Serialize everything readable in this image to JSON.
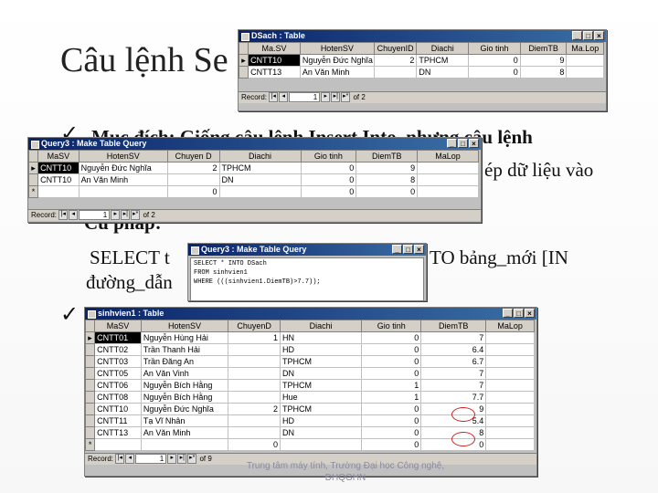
{
  "slide": {
    "title": "Câu lệnh Se",
    "bullet1": "Mục đích: Giống câu lệnh Insert Into, nhưng câu lệnh",
    "bullet1_line2": "ép dữ liệu vào",
    "bullet2": "Cú pháp:",
    "syntax_line1_a": "SELECT t",
    "syntax_line1_b": "TO bảng_mới [IN",
    "syntax_line2": "đường_dẫn",
    "footer": "Trung tâm máy tính, Trường Đại học Công nghệ, ĐHQGHN"
  },
  "dsach": {
    "title": "DSach : Table",
    "columns": [
      "Ma.SV",
      "HotenSV",
      "ChuyenID",
      "Diachi",
      "Gio tinh",
      "DiemTB",
      "Ma.Lop"
    ],
    "rows": [
      [
        "CNTT10",
        "Nguyễn Đức Nghĩa",
        "2",
        "TPHCM",
        "0",
        "9",
        ""
      ],
      [
        "CNTT13",
        "An Văn Minh",
        "",
        "DN",
        "0",
        "8",
        ""
      ]
    ],
    "nav": {
      "label": "Record:",
      "current": "1",
      "of": "of 2"
    }
  },
  "query3a": {
    "title": "Query3 : Make Table Query",
    "columns": [
      "MaSV",
      "HotenSV",
      "Chuyen D",
      "Diachi",
      "Gio tinh",
      "DiemTB",
      "MaLop"
    ],
    "rows": [
      [
        "CNTT10",
        "Nguyễn Đức Nghĩa",
        "2",
        "TPHCM",
        "0",
        "9",
        ""
      ],
      [
        "CNTT10",
        "An Văn Minh",
        "",
        "DN",
        "0",
        "8",
        ""
      ],
      [
        "",
        "",
        "0",
        "",
        "0",
        "0",
        ""
      ]
    ],
    "nav": {
      "label": "Record:",
      "current": "1",
      "of": "of 2"
    }
  },
  "query3b": {
    "title": "Query3 : Make Table Query",
    "sql": "SELECT * INTO DSach\nFROM sinhvien1\nWHERE (((sinhvien1.DiemTB)>7.7));"
  },
  "sinhvien1": {
    "title": "sinhvien1 : Table",
    "columns": [
      "MaSV",
      "HotenSV",
      "ChuyenD",
      "Diachi",
      "Gio tinh",
      "DiemTB",
      "MaLop"
    ],
    "rows": [
      [
        "CNTT01",
        "Nguyễn Hùng Hải",
        "1",
        "HN",
        "0",
        "7",
        ""
      ],
      [
        "CNTT02",
        "Trần Thanh Hải",
        "",
        "HD",
        "0",
        "6.4",
        ""
      ],
      [
        "CNTT03",
        "Trần Đăng An",
        "",
        "TPHCM",
        "0",
        "6.7",
        ""
      ],
      [
        "CNTT05",
        "An Văn Vinh",
        "",
        "DN",
        "0",
        "7",
        ""
      ],
      [
        "CNTT06",
        "Nguyễn Bích Hằng",
        "",
        "TPHCM",
        "1",
        "7",
        ""
      ],
      [
        "CNTT08",
        "Nguyễn Bích Hằng",
        "",
        "Hue",
        "1",
        "7.7",
        ""
      ],
      [
        "CNTT10",
        "Nguyễn Đức Nghĩa",
        "2",
        "TPHCM",
        "0",
        "9",
        ""
      ],
      [
        "CNTT11",
        "Tạ Vĩ Nhân",
        "",
        "HD",
        "0",
        "5.4",
        ""
      ],
      [
        "CNTT13",
        "An Văn Minh",
        "",
        "DN",
        "0",
        "8",
        ""
      ],
      [
        "",
        "",
        "0",
        "",
        "0",
        "0",
        ""
      ]
    ],
    "nav": {
      "label": "Record:",
      "current": "1",
      "of": "of 9"
    }
  }
}
